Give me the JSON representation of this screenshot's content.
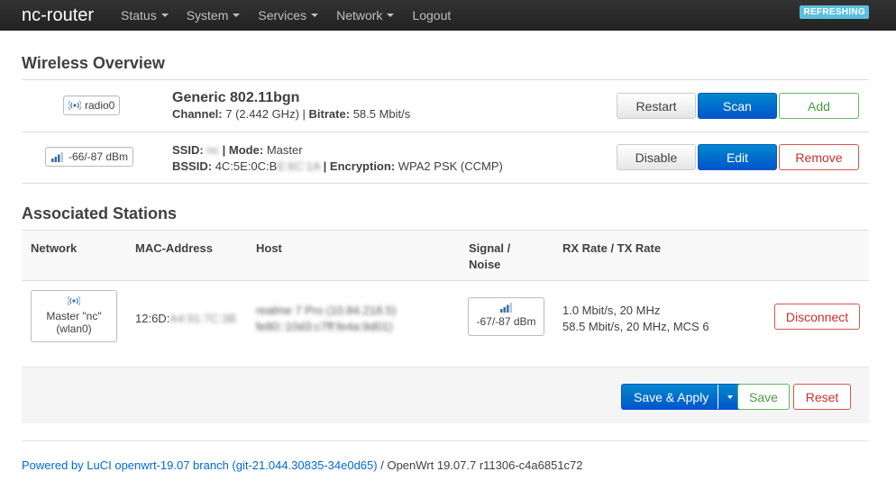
{
  "nav": {
    "brand": "nc-router",
    "items": [
      {
        "label": "Status",
        "dropdown": true
      },
      {
        "label": "System",
        "dropdown": true
      },
      {
        "label": "Services",
        "dropdown": true
      },
      {
        "label": "Network",
        "dropdown": true
      },
      {
        "label": "Logout",
        "dropdown": false
      }
    ],
    "refresh_badge": "REFRESHING"
  },
  "wireless_overview": {
    "heading": "Wireless Overview",
    "radio": {
      "badge": "radio0",
      "title": "Generic 802.11bgn",
      "channel_label": "Channel:",
      "channel_value": "7 (2.442 GHz)",
      "sep": "|",
      "bitrate_label": "Bitrate:",
      "bitrate_value": "58.5 Mbit/s",
      "buttons": {
        "restart": "Restart",
        "scan": "Scan",
        "add": "Add"
      }
    },
    "network": {
      "badge": "-66/-87 dBm",
      "ssid_label": "SSID:",
      "ssid_value": "nc",
      "mode_label": "| Mode:",
      "mode_value": "Master",
      "bssid_label": "BSSID:",
      "bssid_value": "4C:5E:0C:B",
      "bssid_hidden": "E:6C:1A",
      "encryption_label": "| Encryption:",
      "encryption_value": "WPA2 PSK (CCMP)",
      "buttons": {
        "disable": "Disable",
        "edit": "Edit",
        "remove": "Remove"
      }
    }
  },
  "stations": {
    "heading": "Associated Stations",
    "columns": {
      "network": "Network",
      "mac": "MAC-Address",
      "host": "Host",
      "signal_1": "Signal /",
      "signal_2": "Noise",
      "rate": "RX Rate / TX Rate"
    },
    "rows": [
      {
        "network_line1": "Master \"nc\"",
        "network_line2": "(wlan0)",
        "mac": "12:6D:",
        "mac_hidden": "A4:91:7C:3B",
        "host_line1": "realme 7 Pro (10.84.218.5)",
        "host_line2": "fe80::10d3:c7ff:fe4a:9d01)",
        "signal": "-67/-87 dBm",
        "rx": "1.0 Mbit/s, 20 MHz",
        "tx": "58.5 Mbit/s, 20 MHz, MCS 6",
        "disconnect": "Disconnect"
      }
    ]
  },
  "actions": {
    "save_apply": "Save & Apply",
    "save": "Save",
    "reset": "Reset"
  },
  "footer": {
    "link": "Powered by LuCI openwrt-19.07 branch (git-21.044.30835-34e0d65)",
    "rest": "/ OpenWrt 19.07.7 r11306-c4a6851c72"
  }
}
